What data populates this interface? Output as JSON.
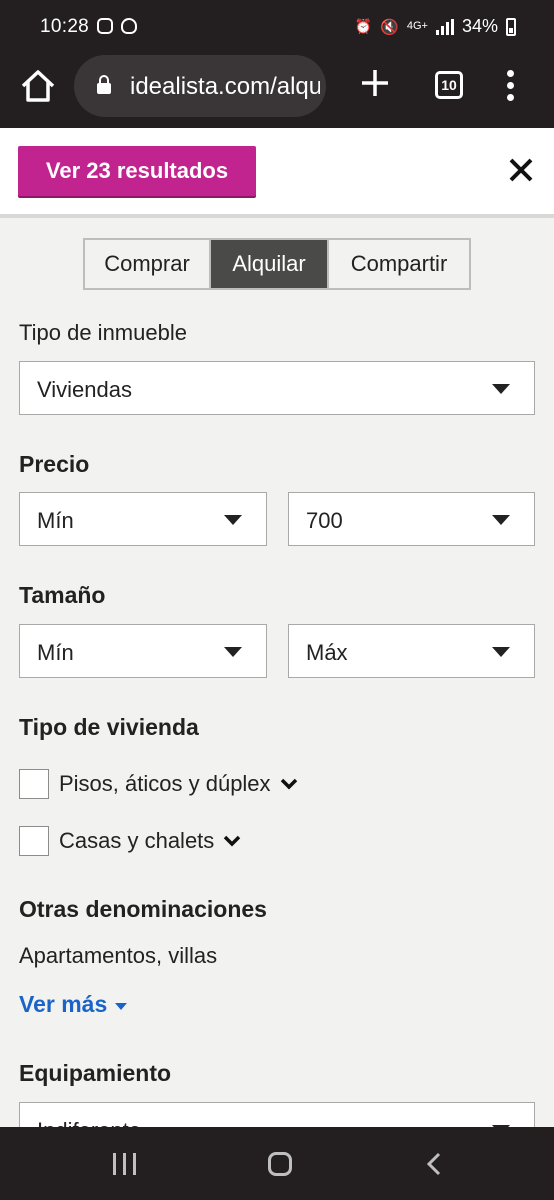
{
  "status_bar": {
    "time": "10:28",
    "network": "4G+",
    "battery": "34%"
  },
  "browser": {
    "url": "idealista.com/alquiler",
    "tab_count": "10"
  },
  "header": {
    "results_button": "Ver 23 resultados",
    "close": "✕"
  },
  "operation": {
    "options": [
      "Comprar",
      "Alquilar",
      "Compartir"
    ],
    "selected": "Alquilar"
  },
  "property_type": {
    "label": "Tipo de inmueble",
    "value": "Viviendas"
  },
  "price": {
    "title": "Precio",
    "min": "Mín",
    "max": "700"
  },
  "size": {
    "title": "Tamaño",
    "min": "Mín",
    "max": "Máx"
  },
  "housing_type": {
    "title": "Tipo de vivienda",
    "options": [
      {
        "label": "Pisos, áticos y dúplex",
        "checked": false
      },
      {
        "label": "Casas y chalets",
        "checked": false
      }
    ]
  },
  "other_names": {
    "title": "Otras denominaciones",
    "text": "Apartamentos, villas",
    "more_link": "Ver más"
  },
  "equipment": {
    "title": "Equipamiento",
    "value": "Indiferente"
  },
  "colors": {
    "accent": "#c2248f",
    "link": "#1a64c8",
    "chrome": "#231f20"
  }
}
